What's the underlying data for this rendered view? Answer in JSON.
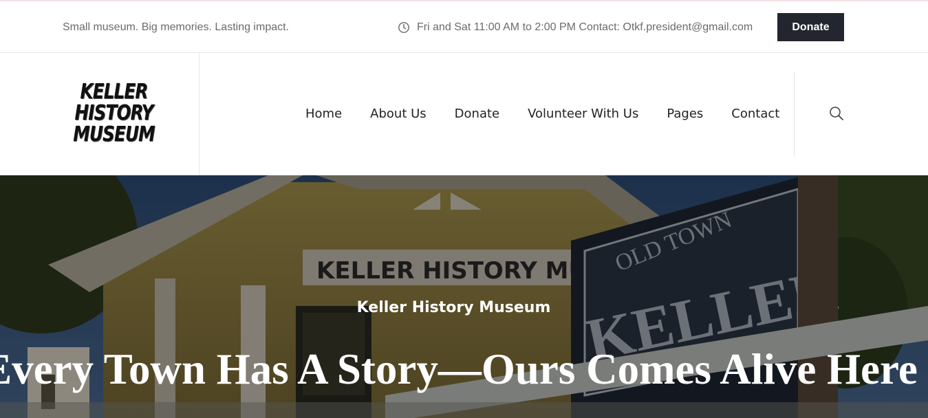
{
  "topbar": {
    "tagline": "Small museum. Big memories. Lasting impact.",
    "hours": "Fri and Sat 11:00 AM to 2:00 PM Contact: Otkf.president@gmail.com",
    "donate_label": "Donate"
  },
  "logo": {
    "lines": [
      "KELLER",
      "HISTORY",
      "MUSEUM"
    ]
  },
  "nav": {
    "items": [
      {
        "label": "Home"
      },
      {
        "label": "About Us"
      },
      {
        "label": "Donate"
      },
      {
        "label": "Volunteer With Us"
      },
      {
        "label": "Pages"
      },
      {
        "label": "Contact"
      }
    ]
  },
  "hero": {
    "kicker": "Keller History Museum",
    "title": "Every Town Has A Story—Ours Comes Alive Here",
    "photo_texts": {
      "building_sign": "KELLER HISTORY MUSEU",
      "sign_top": "OLD TOWN",
      "sign_main": "KELLER"
    }
  },
  "colors": {
    "donate_bg": "#23262e",
    "muted_text": "#6b6b6b",
    "topbar_accent": "#f3e1e4"
  }
}
